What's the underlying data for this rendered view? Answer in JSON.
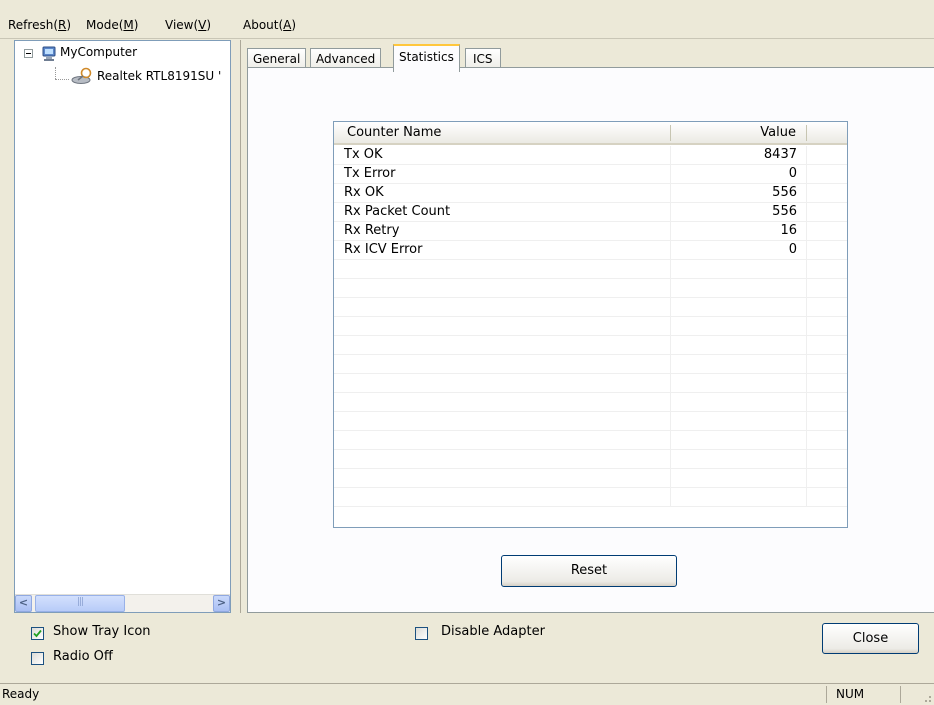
{
  "menu": {
    "items": [
      {
        "label": "Refresh(",
        "accel": "R",
        "tail": ")"
      },
      {
        "label": "Mode(",
        "accel": "M",
        "tail": ")"
      },
      {
        "label": "View(",
        "accel": "V",
        "tail": ")"
      },
      {
        "label": "About(",
        "accel": "A",
        "tail": ")"
      }
    ]
  },
  "tree": {
    "root_label": "MyComputer",
    "child_label": "Realtek RTL8191SU '",
    "root_icon": "computer-icon",
    "child_icon": "network-adapter-icon"
  },
  "tabs": [
    {
      "label": "General"
    },
    {
      "label": "Advanced"
    },
    {
      "label": "Statistics",
      "active": true
    },
    {
      "label": "ICS"
    }
  ],
  "statistics": {
    "columns": {
      "name": "Counter Name",
      "value": "Value"
    },
    "rows": [
      {
        "name": "Tx OK",
        "value": "8437"
      },
      {
        "name": "Tx Error",
        "value": "0"
      },
      {
        "name": "Rx OK",
        "value": "556"
      },
      {
        "name": "Rx Packet Count",
        "value": "556"
      },
      {
        "name": "Rx Retry",
        "value": "16"
      },
      {
        "name": "Rx ICV Error",
        "value": "0"
      },
      {
        "name": "",
        "value": ""
      },
      {
        "name": "",
        "value": ""
      },
      {
        "name": "",
        "value": ""
      },
      {
        "name": "",
        "value": ""
      },
      {
        "name": "",
        "value": ""
      },
      {
        "name": "",
        "value": ""
      },
      {
        "name": "",
        "value": ""
      },
      {
        "name": "",
        "value": ""
      },
      {
        "name": "",
        "value": ""
      },
      {
        "name": "",
        "value": ""
      },
      {
        "name": "",
        "value": ""
      },
      {
        "name": "",
        "value": ""
      },
      {
        "name": "",
        "value": ""
      }
    ],
    "reset_label": "Reset"
  },
  "options": {
    "show_tray_icon": {
      "label": "Show Tray Icon",
      "checked": true
    },
    "radio_off": {
      "label": "Radio Off",
      "checked": false
    },
    "disable_adapter": {
      "label": "Disable Adapter",
      "checked": false
    }
  },
  "close_label": "Close",
  "status": {
    "text": "Ready",
    "num": "NUM"
  },
  "colors": {
    "window_bg": "#ece9d8",
    "active_tab_accent": "#ffc73c",
    "button_border": "#003c74",
    "check_mark": "#21a121"
  }
}
